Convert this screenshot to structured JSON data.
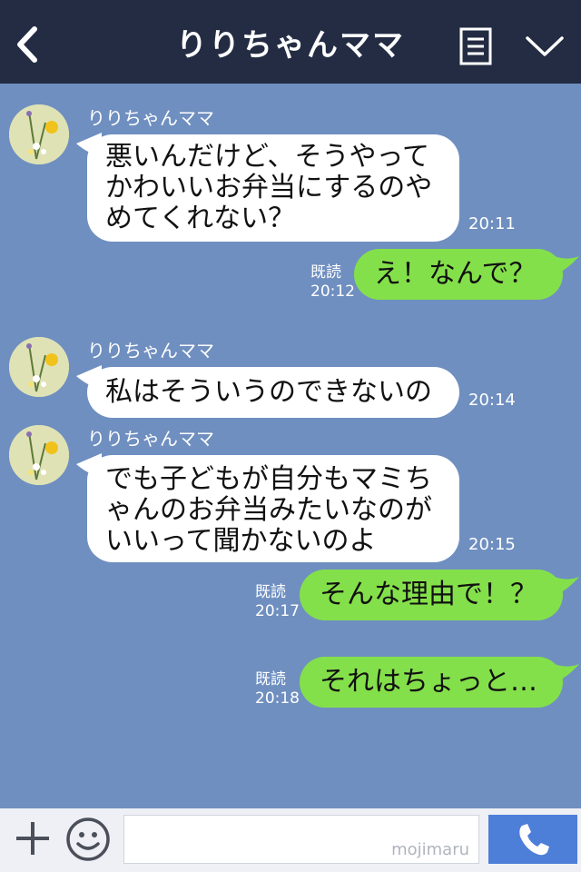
{
  "header": {
    "title": "りりちゃんママ",
    "back_icon": "chevron-left-icon",
    "menu_icon": "list-icon",
    "expand_icon": "chevron-down-icon"
  },
  "messages": [
    {
      "type": "incoming",
      "sender": "りりちゃんママ",
      "lines": [
        "悪いんだけど、そうやって",
        "かわいいお弁当にするのや",
        "めてくれない？"
      ],
      "time": "20:11"
    },
    {
      "type": "outgoing",
      "read": "既読",
      "text": "え！なんで？",
      "time": "20:12"
    },
    {
      "type": "incoming",
      "sender": "りりちゃんママ",
      "lines": [
        "私はそういうのできないの"
      ],
      "time": "20:14"
    },
    {
      "type": "incoming",
      "sender": "りりちゃんママ",
      "lines": [
        "でも子どもが自分もマミち",
        "ゃんのお弁当みたいなのが",
        "いいって聞かないのよ"
      ],
      "time": "20:15"
    },
    {
      "type": "outgoing",
      "read": "既読",
      "text": "そんな理由で！？",
      "time": "20:17"
    },
    {
      "type": "outgoing",
      "read": "既読",
      "text": "それはちょっと…",
      "time": "20:18"
    }
  ],
  "footer": {
    "plus_icon": "plus-icon",
    "emoji_icon": "smiley-icon",
    "input_value": "",
    "watermark": "mojimaru",
    "call_icon": "phone-icon"
  },
  "colors": {
    "header_bg": "#232c43",
    "chat_bg": "#6f8fc0",
    "incoming_bubble": "#ffffff",
    "outgoing_bubble": "#84e04a",
    "call_button": "#4d7fd8"
  }
}
